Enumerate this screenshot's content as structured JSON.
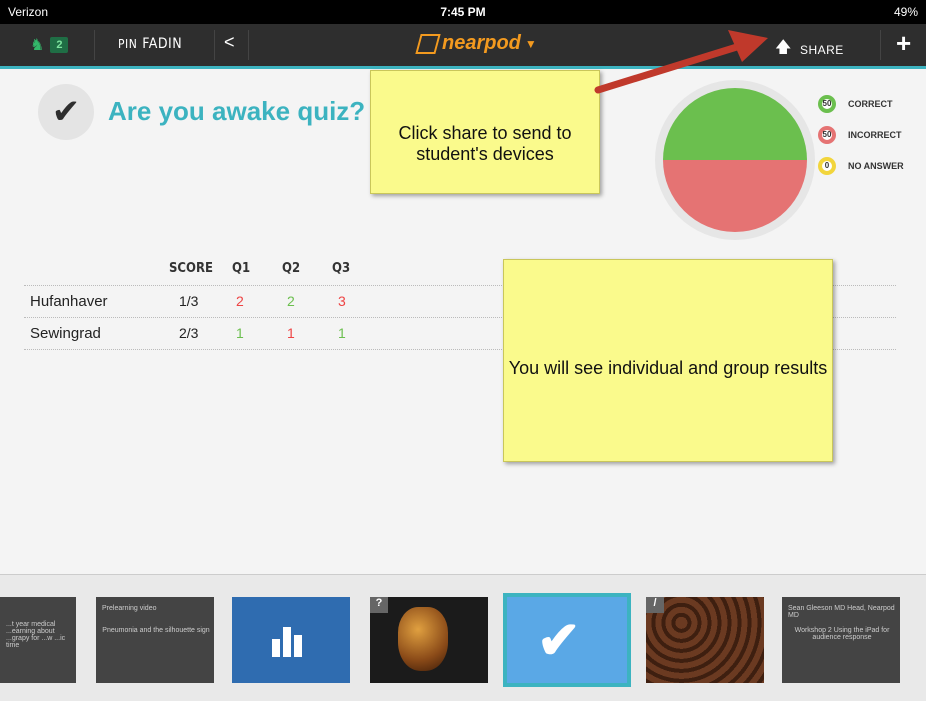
{
  "status_bar": {
    "carrier": "Verizon",
    "time": "7:45 PM",
    "battery": "49%"
  },
  "navbar": {
    "students_count": "2",
    "pin_label": "PIN",
    "pin_code": "FADIN",
    "logo_text": "nearpod",
    "share_label": "SHARE",
    "plus_label": "+"
  },
  "quiz": {
    "title": "Are you awake quiz?"
  },
  "results_chart": {
    "legend": [
      {
        "count": "50",
        "label": "CORRECT",
        "color": "#6bbf4e"
      },
      {
        "count": "50",
        "label": "INCORRECT",
        "color": "#e57373"
      },
      {
        "count": "0",
        "label": "NO ANSWER",
        "color": "#f2d53c"
      }
    ]
  },
  "chart_data": {
    "type": "pie",
    "categories": [
      "CORRECT",
      "INCORRECT",
      "NO ANSWER"
    ],
    "values": [
      50,
      50,
      0
    ],
    "colors": [
      "#6bbf4e",
      "#e57373",
      "#f2d53c"
    ]
  },
  "results_table": {
    "headers": [
      "SCORE",
      "Q1",
      "Q2",
      "Q3"
    ],
    "rows": [
      {
        "name": "Hufanhaver",
        "score": "1/3",
        "q1": "2",
        "q2": "2",
        "q3": "3"
      },
      {
        "name": "Sewingrad",
        "score": "2/3",
        "q1": "1",
        "q2": "1",
        "q3": "1"
      }
    ]
  },
  "notes": {
    "share_tip": "Click share to send to student's devices",
    "results_tip": "You will see individual and group results"
  },
  "filmstrip": {
    "slides": [
      {
        "text": "...t year medical ...earning about ...grapy for ...w ...ic time"
      },
      {
        "title": "Prelearning video",
        "text": "Pneumonia and the silhouette sign"
      },
      {
        "kind": "poll"
      },
      {
        "kind": "3d",
        "badge": "?"
      },
      {
        "kind": "quiz"
      },
      {
        "kind": "draw",
        "badge": "/"
      },
      {
        "title": "Sean Gleeson MD Head, Nearpod MD",
        "text": "Workshop 2 Using the iPad for audience response"
      }
    ]
  }
}
